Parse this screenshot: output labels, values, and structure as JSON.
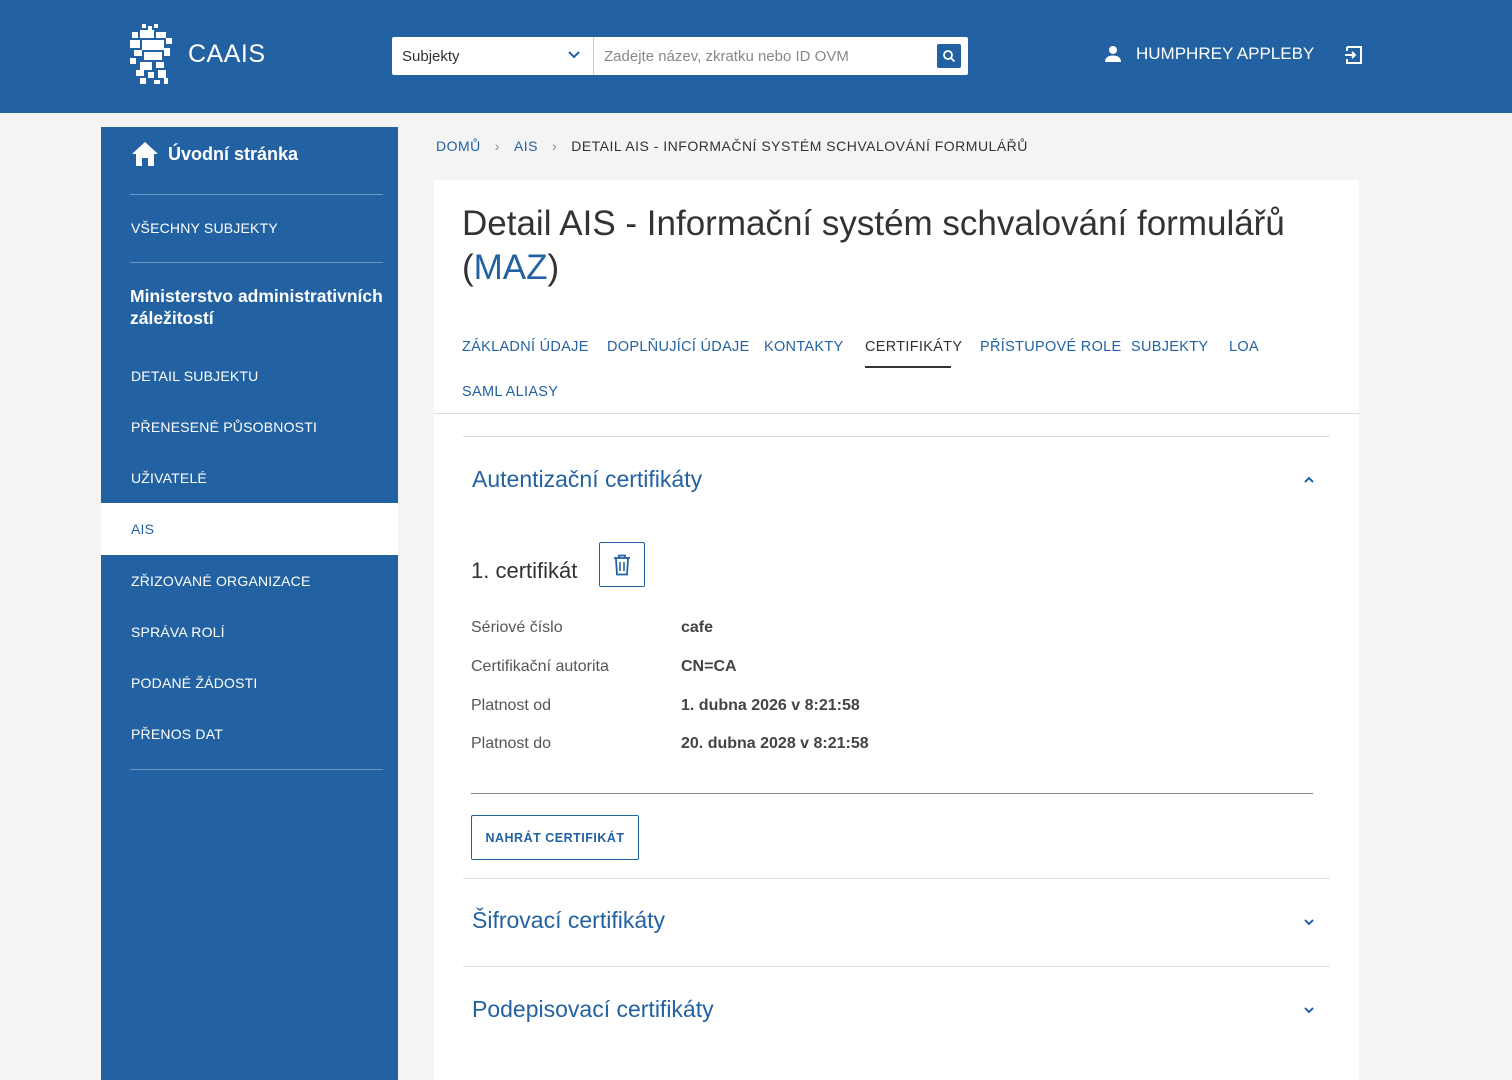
{
  "header": {
    "brand": "CAAIS",
    "search": {
      "select_value": "Subjekty",
      "placeholder": "Zadejte název, zkratku nebo ID OVM"
    },
    "user_name": "HUMPHREY APPLEBY"
  },
  "sidebar": {
    "home_label": "Úvodní stránka",
    "all_subjects": "VŠECHNY SUBJEKTY",
    "org_name": "Ministerstvo administrativních záležitostí",
    "items": [
      {
        "label": "DETAIL SUBJEKTU"
      },
      {
        "label": "PŘENESENÉ PŮSOBNOSTI"
      },
      {
        "label": "UŽIVATELÉ"
      },
      {
        "label": "AIS"
      },
      {
        "label": "ZŘIZOVANÉ ORGANIZACE"
      },
      {
        "label": "SPRÁVA ROLÍ"
      },
      {
        "label": "PODANÉ ŽÁDOSTI"
      },
      {
        "label": "PŘENOS DAT"
      }
    ],
    "active_item": "AIS"
  },
  "breadcrumb": {
    "items": [
      "DOMŮ",
      "AIS"
    ],
    "current": "DETAIL AIS - INFORMAČNÍ SYSTÉM SCHVALOVÁNÍ FORMULÁŘŮ"
  },
  "page": {
    "title": "Detail AIS - Informační systém schvalování formulářů",
    "title_open": "(",
    "abbr": "MAZ",
    "title_close": ")"
  },
  "tabs": [
    {
      "label": "ZÁKLADNÍ ÚDAJE"
    },
    {
      "label": "DOPLŇUJÍCÍ ÚDAJE"
    },
    {
      "label": "KONTAKTY"
    },
    {
      "label": "CERTIFIKÁTY"
    },
    {
      "label": "PŘÍSTUPOVÉ ROLE"
    },
    {
      "label": "SUBJEKTY"
    },
    {
      "label": "LOA"
    },
    {
      "label": "SAML ALIASY"
    }
  ],
  "active_tab": "CERTIFIKÁTY",
  "sections": {
    "auth": {
      "title": "Autentizační certifikáty",
      "expanded": true,
      "certificate": {
        "title": "1. certifikát",
        "fields": [
          {
            "label": "Sériové číslo",
            "value": "cafe"
          },
          {
            "label": "Certifikační autorita",
            "value": "CN=CA"
          },
          {
            "label": "Platnost od",
            "value": "1. dubna 2026 v 8:21:58"
          },
          {
            "label": "Platnost do",
            "value": "20. dubna 2028 v 8:21:58"
          }
        ]
      },
      "upload_label": "NAHRÁT CERTIFIKÁT"
    },
    "encryption": {
      "title": "Šifrovací certifikáty",
      "expanded": false
    },
    "signing": {
      "title": "Podepisovací certifikáty",
      "expanded": false
    }
  },
  "colors": {
    "primary": "#2362a2",
    "background": "#f4f4f4",
    "card": "#ffffff",
    "divider": "#dddddd"
  }
}
